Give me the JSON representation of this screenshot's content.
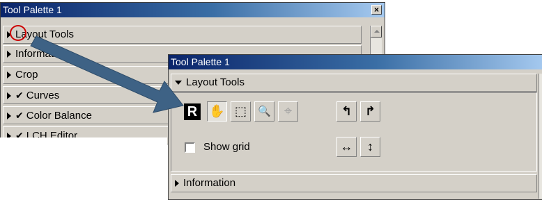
{
  "back_palette": {
    "title": "Tool Palette 1",
    "close_glyph": "×",
    "rows": [
      {
        "label": "Layout Tools",
        "checked": false
      },
      {
        "label": "Information",
        "checked": false
      },
      {
        "label": "Crop",
        "checked": false
      },
      {
        "label": "Curves",
        "checked": true
      },
      {
        "label": "Color Balance",
        "checked": true
      },
      {
        "label": "LCH Editor",
        "checked": true
      }
    ]
  },
  "front_palette": {
    "title": "Tool Palette 1",
    "layout_section": {
      "label": "Layout Tools",
      "expanded": true
    },
    "tools": [
      {
        "name": "rotate-tool",
        "glyph": "R"
      },
      {
        "name": "hand-tool",
        "glyph": "✋"
      },
      {
        "name": "marquee-tool",
        "glyph": "⬚"
      },
      {
        "name": "zoom-tool",
        "glyph": "🔍"
      },
      {
        "name": "target-tool",
        "glyph": "⌖"
      },
      {
        "name": "rotate-left-tool",
        "glyph": "↰"
      },
      {
        "name": "rotate-right-tool",
        "glyph": "↱"
      },
      {
        "name": "flip-horizontal-tool",
        "glyph": "↔"
      },
      {
        "name": "flip-vertical-tool",
        "glyph": "↕"
      }
    ],
    "show_grid_label": "Show grid",
    "show_grid_checked": false,
    "info_section": {
      "label": "Information"
    }
  },
  "annotation": {
    "highlight_color": "#cc0000",
    "arrow_color": "#3e6285"
  }
}
